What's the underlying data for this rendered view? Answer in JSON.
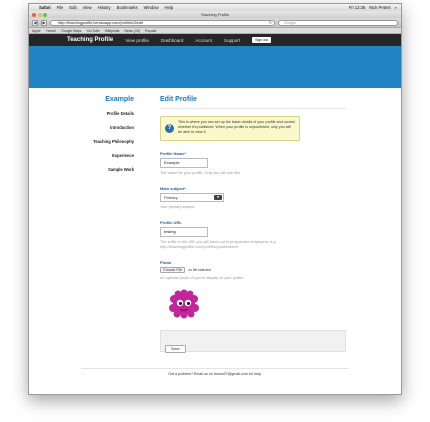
{
  "mac_menu": {
    "app": "Safari",
    "items": [
      "File",
      "Edit",
      "View",
      "History",
      "Bookmarks",
      "Window",
      "Help"
    ],
    "status": "Fri 12:36",
    "user": "Nick Peters"
  },
  "window": {
    "title": "Teaching Profile"
  },
  "toolbar": {
    "url": "http://teachingprofile.herokuapp.com/profiles/3/edit",
    "search_placeholder": "Google",
    "back": "◀",
    "forward": "▶"
  },
  "bookmarks": [
    "Apple",
    "Yahoo!",
    "Google Maps",
    "YouTube",
    "Wikipedia",
    "News (15)",
    "Popular"
  ],
  "site": {
    "brand": "Teaching Profile",
    "nav": [
      "View profile",
      "Dashboard",
      "Account",
      "Support"
    ],
    "signout": "Sign out"
  },
  "sidebar": {
    "title": "Example",
    "items": [
      "Profile Details",
      "Introduction",
      "Teaching Philosophy",
      "Experience",
      "Sample Work"
    ]
  },
  "main": {
    "heading": "Edit Profile",
    "info": "This is where you can set up the basic details of your profile and control whether it's published. When your profile is unpublished, only you will be able to view it.",
    "profile_name": {
      "label": "Profile Name*",
      "value": "Example",
      "help": "The name for your profile. Only you will see this."
    },
    "main_subject": {
      "label": "Main subject*",
      "value": "Primary",
      "help": "Your primary subject"
    },
    "profile_url": {
      "label": "Profile URL",
      "value": "testing",
      "help": "The suffix to the URL you will hand out to prospective employers, e.g. http://teachingprofile.com/profiles/yourtexthere"
    },
    "photo": {
      "label": "Photo",
      "button": "Choose File",
      "file_status": "no file selected",
      "help": "An optional photo of you to display on your profile."
    },
    "save": "Save"
  },
  "footer": "Got a problem? Email us on fmoon07@gmail.com for help."
}
